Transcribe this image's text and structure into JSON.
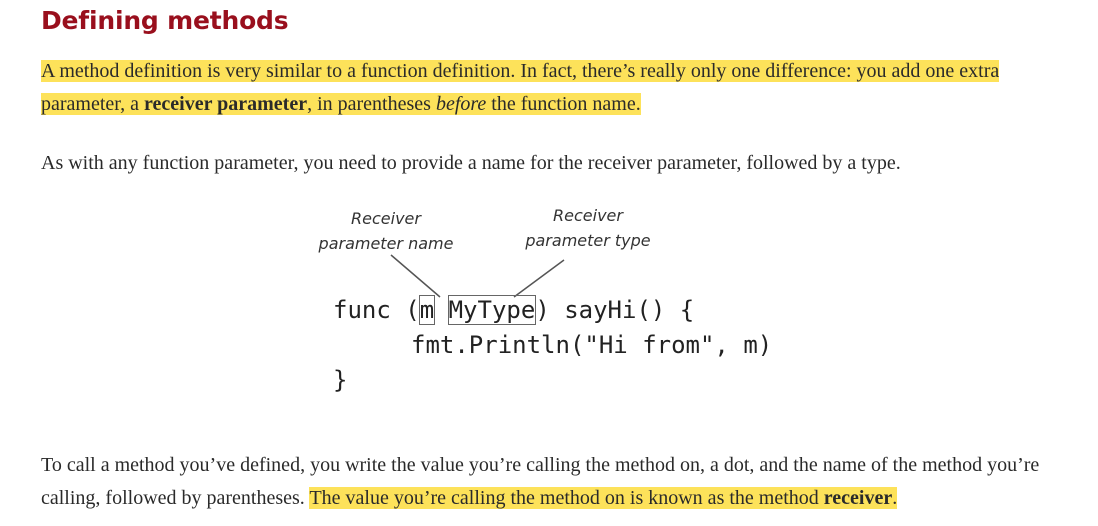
{
  "heading": "Defining methods",
  "para1": {
    "part1": "A method definition is very similar to a function definition. In fact, there’s really only one difference: you add one extra parameter, a ",
    "bold": "receiver parameter",
    "part2": ", in parentheses ",
    "italic": "before",
    "part3": " the function name."
  },
  "para2": "As with any function parameter, you need to provide a name for the receiver parameter, followed by a type.",
  "diagram": {
    "label_name_line1": "Receiver",
    "label_name_line2": "parameter name",
    "label_type_line1": "Receiver",
    "label_type_line2": "parameter type",
    "code": {
      "kw_func": "func",
      "open_paren": " (",
      "receiver_name": "m",
      "space": " ",
      "receiver_type": "MyType",
      "rest_line1": ") sayHi() {",
      "line2": "fmt.Println(\"Hi from\", m)",
      "line3": "}"
    }
  },
  "para3": {
    "part1": "To call a method you’ve defined, you write the value you’re calling the method on, a dot, and the name of the method you’re calling, followed by parentheses. ",
    "hl_part": "The value you’re calling the method on is known as the method ",
    "hl_bold": "receiver",
    "hl_end": "."
  }
}
